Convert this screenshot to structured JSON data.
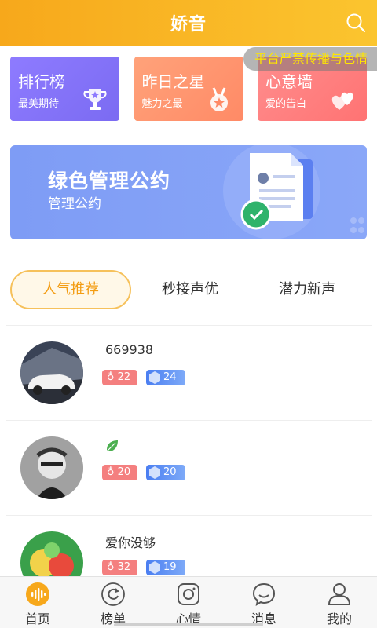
{
  "header": {
    "title": "娇音"
  },
  "notice": {
    "text": "平台严禁传播与色情"
  },
  "cards": [
    {
      "title": "排行榜",
      "subtitle": "最美期待"
    },
    {
      "title": "昨日之星",
      "subtitle": "魅力之最"
    },
    {
      "title": "心意墙",
      "subtitle": "爱的告白"
    }
  ],
  "banner": {
    "title": "绿色管理公约",
    "subtitle": "管理公约"
  },
  "tabs": [
    {
      "label": "人气推荐",
      "active": true
    },
    {
      "label": "秒接声优",
      "active": false
    },
    {
      "label": "潜力新声",
      "active": false
    }
  ],
  "list": [
    {
      "name": "669938",
      "hearts": "22",
      "level": "24"
    },
    {
      "name": "",
      "hearts": "20",
      "level": "20"
    },
    {
      "name": "爱你没够",
      "hearts": "32",
      "level": "19"
    }
  ],
  "nav": [
    {
      "label": "首页",
      "icon": "voice-wave-icon",
      "active": true
    },
    {
      "label": "榜单",
      "icon": "refresh-circle-icon",
      "active": false
    },
    {
      "label": "心情",
      "icon": "camera-icon",
      "active": false
    },
    {
      "label": "消息",
      "icon": "chat-bubble-icon",
      "active": false
    },
    {
      "label": "我的",
      "icon": "user-icon",
      "active": false
    }
  ],
  "colors": {
    "accent": "#f7a81b",
    "active_tab": "#f39c12",
    "heart_badge": "#f47f7f",
    "level_badge": "#4a7ef1"
  }
}
